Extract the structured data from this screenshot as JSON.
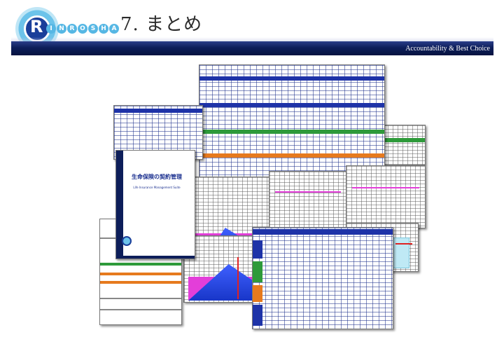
{
  "header": {
    "logo_letters": [
      "R",
      "I",
      "N",
      "R",
      "O",
      "S",
      "H",
      "A"
    ],
    "title": "7. まとめ",
    "tagline": "Accountability & Best Choice"
  },
  "colors": {
    "band": "#0d1e5a",
    "accent": "#1e33a8",
    "logo_light": "#6cc3ea"
  },
  "collage": {
    "cover": {
      "title": "生命保険の契約管理",
      "subtitle": "Life Insurance Management Suite"
    }
  }
}
